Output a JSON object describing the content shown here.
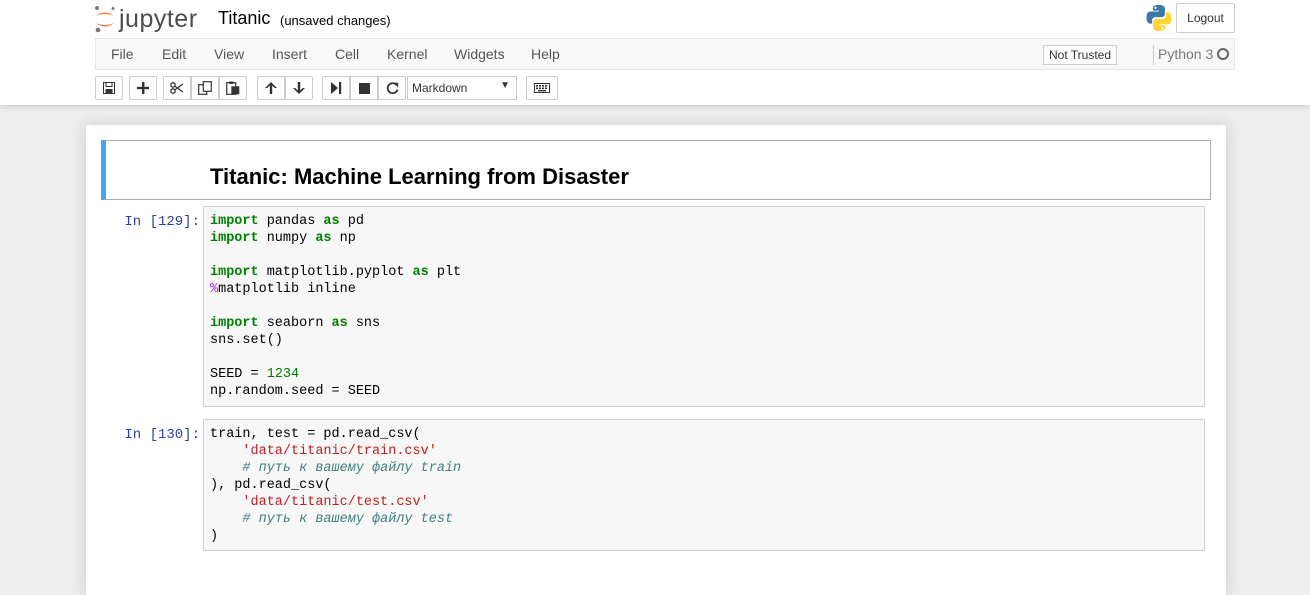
{
  "header": {
    "logo_text": "jupyter",
    "notebook_title": "Titanic",
    "save_status": "(unsaved changes)",
    "logout_label": "Logout"
  },
  "menubar": {
    "items": [
      "File",
      "Edit",
      "View",
      "Insert",
      "Cell",
      "Kernel",
      "Widgets",
      "Help"
    ],
    "trust_label": "Not Trusted",
    "kernel_name": "Python 3"
  },
  "toolbar": {
    "buttons": [
      "save-icon",
      "plus-icon",
      "scissors-icon",
      "copy-icon",
      "paste-icon",
      "arrow-up-icon",
      "arrow-down-icon",
      "step-forward-icon",
      "stop-icon",
      "refresh-icon",
      "keyboard-icon"
    ],
    "cell_type": "Markdown"
  },
  "cells": {
    "markdown": {
      "heading": "Titanic: Machine Learning from Disaster"
    },
    "code1": {
      "prompt": "In [129]:",
      "lines": {
        "l1": {
          "a": "import",
          "b": " pandas ",
          "c": "as",
          "d": " pd"
        },
        "l2": {
          "a": "import",
          "b": " numpy ",
          "c": "as",
          "d": " np"
        },
        "l4": {
          "a": "import",
          "b": " matplotlib.pyplot ",
          "c": "as",
          "d": " plt"
        },
        "l5": {
          "a": "%",
          "b": "matplotlib inline"
        },
        "l7": {
          "a": "import",
          "b": " seaborn ",
          "c": "as",
          "d": " sns"
        },
        "l8": "sns.set()",
        "l10": {
          "a": "SEED = ",
          "b": "1234"
        },
        "l11": "np.random.seed = SEED"
      }
    },
    "code2": {
      "prompt": "In [130]:",
      "lines": {
        "l1": "train, test = pd.read_csv(",
        "l2": "'data/titanic/train.csv'",
        "l3": "# путь к вашему файлу train",
        "l4": "), pd.read_csv(",
        "l5": "'data/titanic/test.csv'",
        "l6": "# путь к вашему файлу test",
        "l7": ")"
      }
    }
  },
  "colors": {
    "keyword": "#008000",
    "magic": "#aa22ff",
    "string": "#ba2121",
    "comment": "#408080",
    "prompt": "#303f9f",
    "selected_cell_border": "#42a5f5"
  }
}
